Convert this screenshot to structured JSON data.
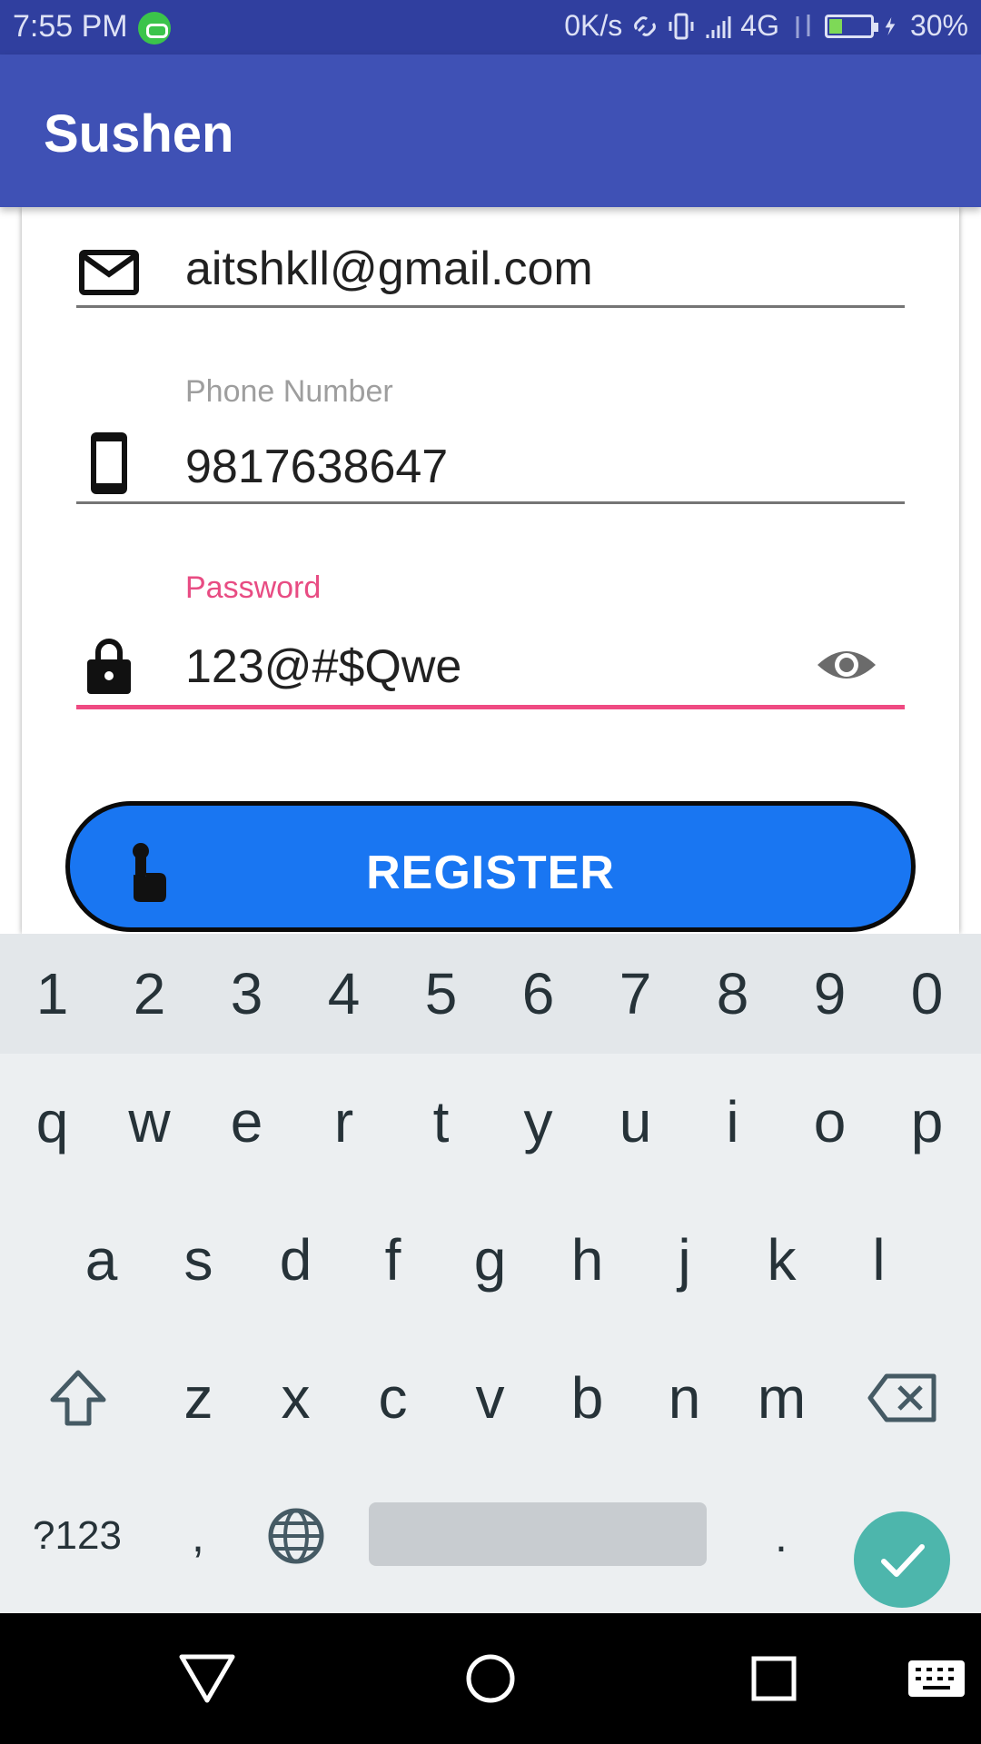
{
  "status_bar": {
    "time": "7:55 PM",
    "speed": "0K/s",
    "network": "4G",
    "battery": "30%"
  },
  "app_bar": {
    "title": "Sushen"
  },
  "form": {
    "email_value": "aitshkll@gmail.com",
    "phone_label": "Phone Number",
    "phone_value": "9817638647",
    "password_label": "Password",
    "password_value": "123@#$Qwe",
    "register_label": "REGISTER",
    "accent_color": "#ef4a82",
    "button_color": "#1976f2"
  },
  "keyboard": {
    "numbers": [
      "1",
      "2",
      "3",
      "4",
      "5",
      "6",
      "7",
      "8",
      "9",
      "0"
    ],
    "row1": [
      "q",
      "w",
      "e",
      "r",
      "t",
      "y",
      "u",
      "i",
      "o",
      "p"
    ],
    "row2": [
      "a",
      "s",
      "d",
      "f",
      "g",
      "h",
      "j",
      "k",
      "l"
    ],
    "row3": [
      "z",
      "x",
      "c",
      "v",
      "b",
      "n",
      "m"
    ],
    "symbols_label": "?123",
    "comma": ",",
    "period": "."
  }
}
